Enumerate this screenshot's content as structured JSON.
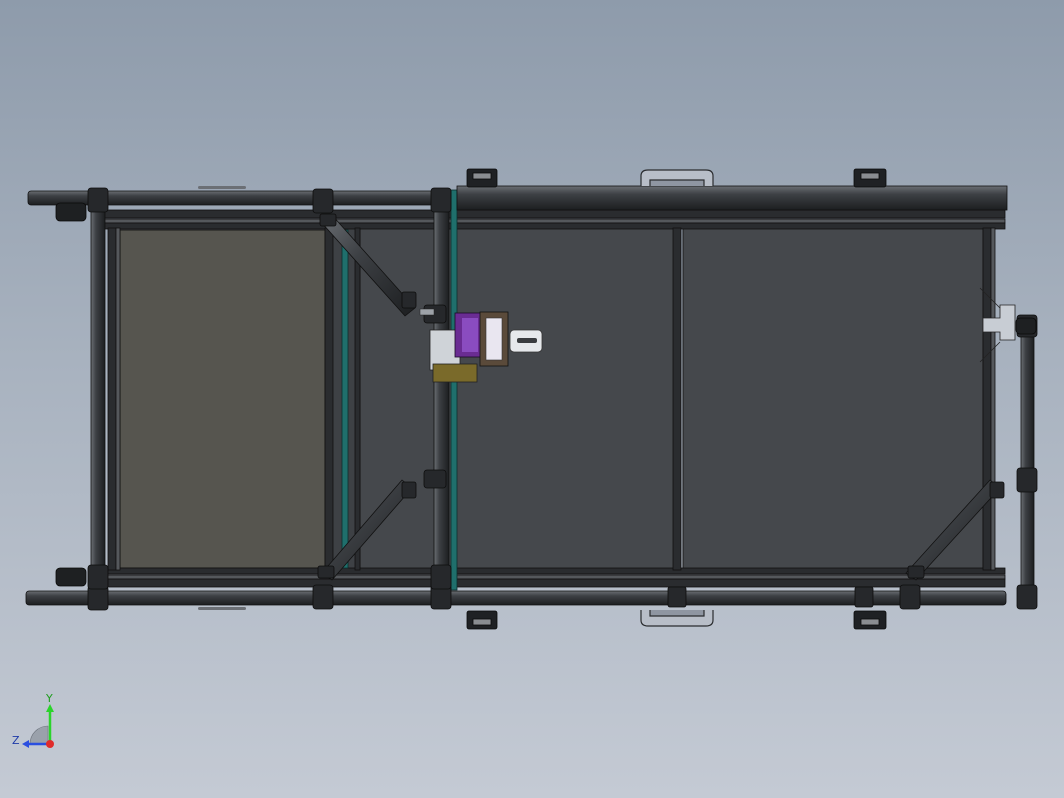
{
  "viewport": {
    "background_top": "#8e9bab",
    "background_bottom": "#c4cad4"
  },
  "model": {
    "frame_tube_color": "#3c3f43",
    "panel_color": "#45484c",
    "left_panel_color": "#56554f",
    "teal_accent": "#1f6f6c",
    "purple_accent": "#6a2c93",
    "olive_accent": "#7a6a2a"
  },
  "triad": {
    "y_label": "Y",
    "z_label": "Z",
    "y_color": "#2bd42b",
    "z_color": "#2b4fe0",
    "x_color": "#e02b2b"
  }
}
